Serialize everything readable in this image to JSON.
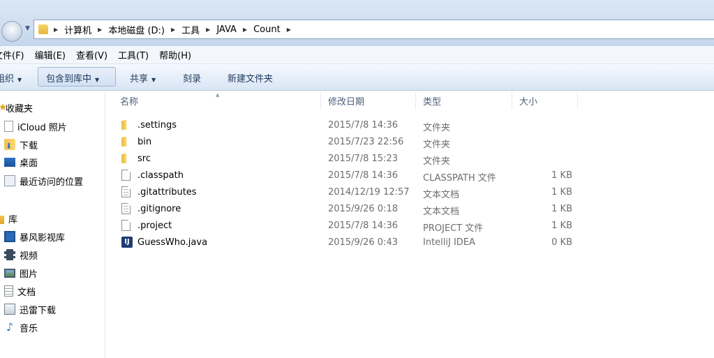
{
  "address": {
    "breadcrumbs": [
      "计算机",
      "本地磁盘 (D:)",
      "工具",
      "JAVA",
      "Count"
    ]
  },
  "menu": [
    "文件(F)",
    "编辑(E)",
    "查看(V)",
    "工具(T)",
    "帮助(H)"
  ],
  "toolbar": {
    "organize": "组织",
    "include_in_library": "包含到库中",
    "share": "共享",
    "burn": "刻录",
    "new_folder": "新建文件夹"
  },
  "nav": {
    "favorites": "收藏夹",
    "icloud": "iCloud 照片",
    "downloads": "下载",
    "desktop": "桌面",
    "recent": "最近访问的位置",
    "libraries": "库",
    "baofeng": "暴风影视库",
    "videos": "视频",
    "pictures": "图片",
    "documents": "文档",
    "xunlei": "迅雷下载",
    "music": "音乐"
  },
  "columns": {
    "name": "名称",
    "date": "修改日期",
    "type": "类型",
    "size": "大小"
  },
  "files": [
    {
      "name": ".settings",
      "date": "2015/7/8 14:36",
      "type": "文件夹",
      "size": "",
      "icon": "folder-icon"
    },
    {
      "name": "bin",
      "date": "2015/7/23 22:56",
      "type": "文件夹",
      "size": "",
      "icon": "folder-icon"
    },
    {
      "name": "src",
      "date": "2015/7/8 15:23",
      "type": "文件夹",
      "size": "",
      "icon": "folder-icon"
    },
    {
      "name": ".classpath",
      "date": "2015/7/8 14:36",
      "type": "CLASSPATH 文件",
      "size": "1 KB",
      "icon": "file-icon"
    },
    {
      "name": ".gitattributes",
      "date": "2014/12/19 12:57",
      "type": "文本文档",
      "size": "1 KB",
      "icon": "text-document-icon"
    },
    {
      "name": ".gitignore",
      "date": "2015/9/26 0:18",
      "type": "文本文档",
      "size": "1 KB",
      "icon": "text-document-icon"
    },
    {
      "name": ".project",
      "date": "2015/7/8 14:36",
      "type": "PROJECT 文件",
      "size": "1 KB",
      "icon": "file-icon"
    },
    {
      "name": "GuessWho.java",
      "date": "2015/9/26 0:43",
      "type": "IntelliJ IDEA",
      "size": "0 KB",
      "icon": "intellij-icon"
    }
  ]
}
